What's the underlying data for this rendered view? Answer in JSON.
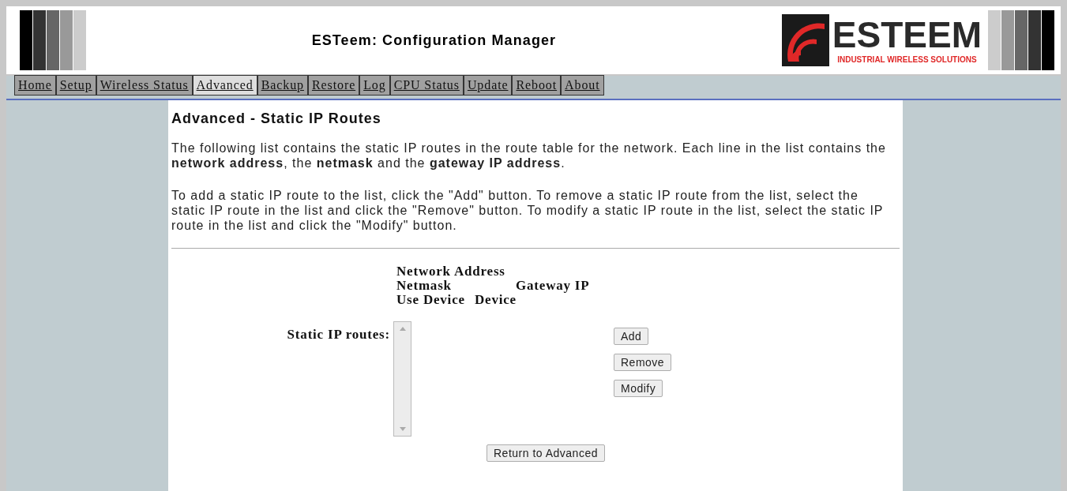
{
  "header": {
    "title": "ESTeem: Configuration Manager",
    "logo": {
      "name": "ESTEEM",
      "tagline": "INDUSTRIAL WIRELESS SOLUTIONS"
    }
  },
  "nav": [
    {
      "label": "Home",
      "selected": false
    },
    {
      "label": "Setup",
      "selected": false
    },
    {
      "label": "Wireless Status",
      "selected": false
    },
    {
      "label": "Advanced",
      "selected": true
    },
    {
      "label": "Backup",
      "selected": false
    },
    {
      "label": "Restore",
      "selected": false
    },
    {
      "label": "Log",
      "selected": false
    },
    {
      "label": "CPU Status",
      "selected": false
    },
    {
      "label": "Update",
      "selected": false
    },
    {
      "label": "Reboot",
      "selected": false
    },
    {
      "label": "About",
      "selected": false
    }
  ],
  "page": {
    "title": "Advanced - Static IP Routes",
    "paragraphs": [
      "The following list contains the static IP routes in the route table for the network. Each line in the list contains the **network address**, the **netmask** and the **gateway IP address**.",
      "To add a static IP route to the list, click the \"Add\" button. To remove a static IP route from the list, select the static IP route in the list and click the \"Remove\" button. To modify a static IP route in the list, select the static IP route in the list and click the \"Modify\" button."
    ]
  },
  "routes_form": {
    "column_headers": [
      "Network Address",
      "Netmask",
      "Gateway IP",
      "Use Device",
      "Device"
    ],
    "label": "Static IP routes:",
    "side_buttons": [
      "Add",
      "Remove",
      "Modify"
    ],
    "return_button": "Return to Advanced"
  }
}
